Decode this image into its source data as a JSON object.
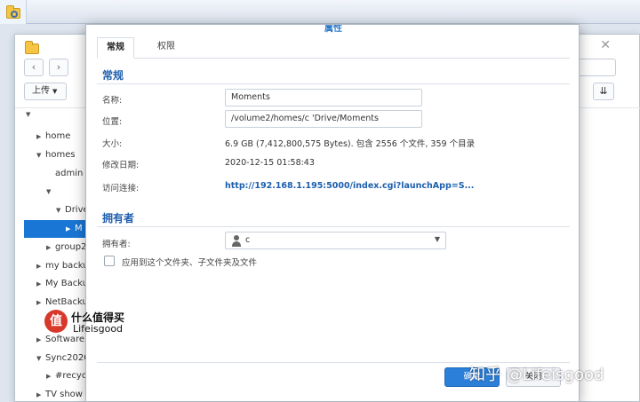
{
  "fs": {
    "nav_back": "‹",
    "nav_forward": "›",
    "upload_label": "上传",
    "tree": [
      {
        "label": "home",
        "expander": "right",
        "indent": 0
      },
      {
        "label": "homes",
        "expander": "down",
        "indent": 0
      },
      {
        "label": "admin",
        "expander": "none",
        "indent": 1
      },
      {
        "label": "",
        "expander": "down",
        "indent": 1
      },
      {
        "label": "Drive",
        "expander": "down",
        "indent": 2
      },
      {
        "label": "M",
        "expander": "right",
        "indent": 3,
        "selected": true
      },
      {
        "label": "group2",
        "expander": "right",
        "indent": 1
      },
      {
        "label": "my backu",
        "expander": "right",
        "indent": 0
      },
      {
        "label": "My Backu",
        "expander": "right",
        "indent": 0
      },
      {
        "label": "NetBacku",
        "expander": "right",
        "indent": 0
      },
      {
        "label": "",
        "expander": "none",
        "indent": 0
      },
      {
        "label": "Software",
        "expander": "right",
        "indent": 0
      },
      {
        "label": "Sync2020",
        "expander": "down",
        "indent": 0
      },
      {
        "label": "#recyc",
        "expander": "right",
        "indent": 1
      },
      {
        "label": "TV show",
        "expander": "right",
        "indent": 0
      }
    ]
  },
  "dialog": {
    "title": "属性",
    "tabs": [
      "常规",
      "权限"
    ],
    "general": {
      "section_title": "常规",
      "name_label": "名称:",
      "name_value": "Moments",
      "location_label": "位置:",
      "location_value": "/volume2/homes/c                    'Drive/Moments",
      "size_label": "大小:",
      "size_value": "6.9 GB (7,412,800,575 Bytes). 包含 2556 个文件,  359 个目录",
      "modified_label": "修改日期:",
      "modified_value": "2020-12-15 01:58:43",
      "link_label": "访问连接:",
      "link_value": "http://192.168.1.195:5000/index.cgi?launchApp=S..."
    },
    "owner": {
      "section_title": "拥有者",
      "owner_label": "拥有者:",
      "owner_value": "c",
      "apply_label": "应用到这个文件夹、子文件夹及文件"
    },
    "buttons": {
      "ok": "确定",
      "cancel": "关闭"
    }
  },
  "watermarks": {
    "logo_char": "值",
    "line1": "什么值得买",
    "line2": "Lifeisgood",
    "right": "知乎 @Lifeisgood"
  }
}
